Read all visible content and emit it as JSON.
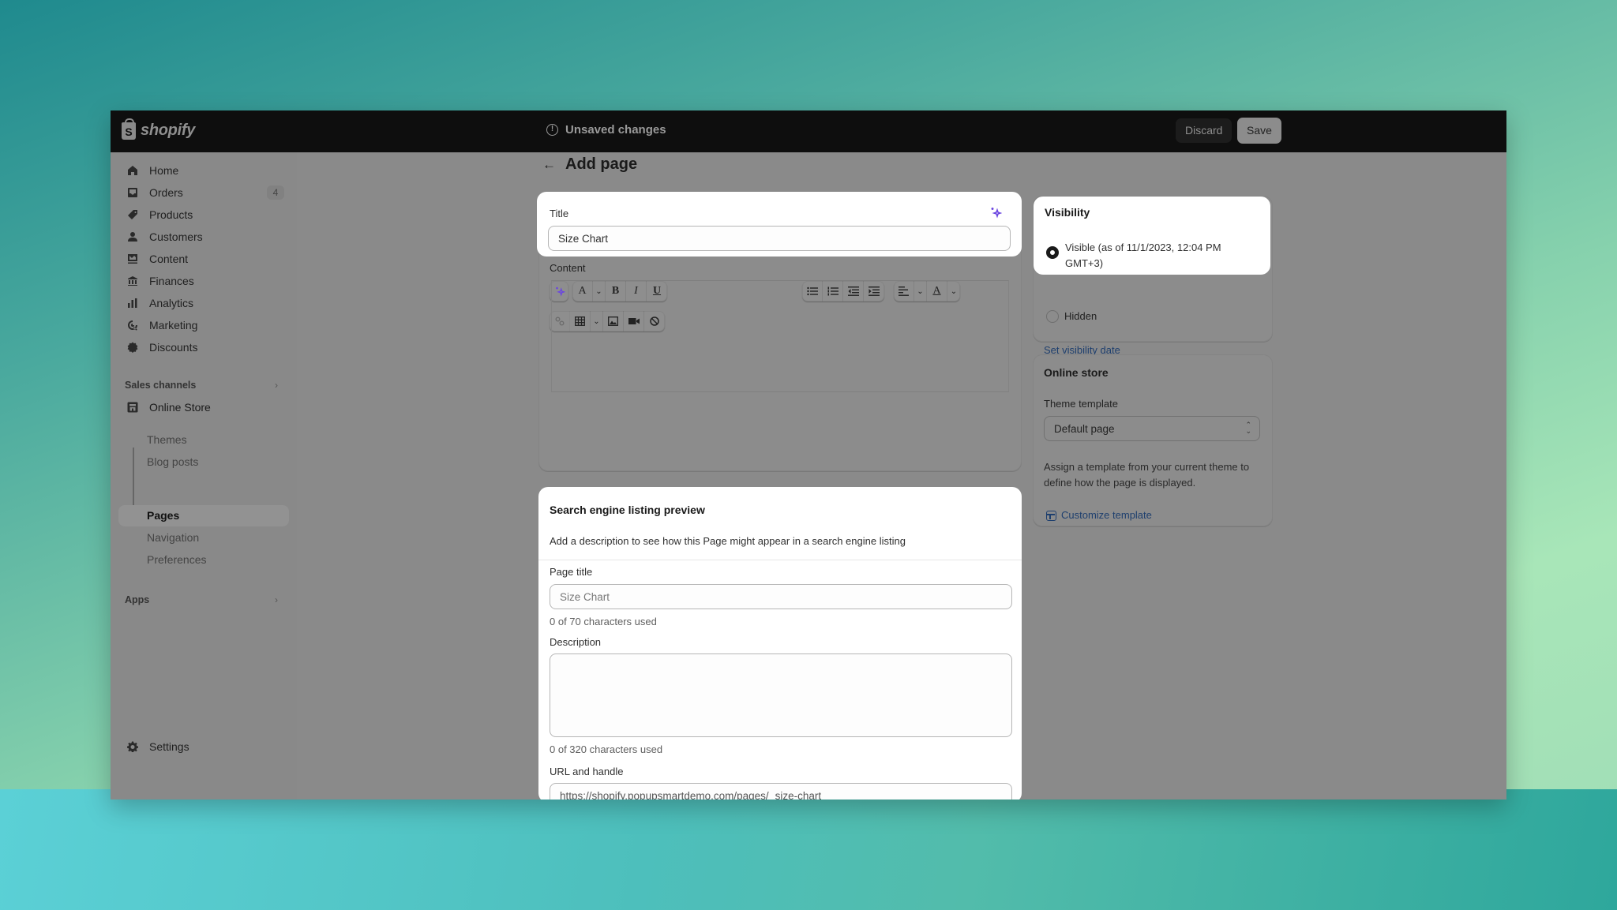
{
  "topbar": {
    "logo_text": "shopify",
    "status_text": "Unsaved changes",
    "discard_label": "Discard",
    "save_label": "Save"
  },
  "sidebar": {
    "items": [
      {
        "label": "Home",
        "icon": "home-icon"
      },
      {
        "label": "Orders",
        "icon": "inbox-icon",
        "badge": "4"
      },
      {
        "label": "Products",
        "icon": "tag-icon"
      },
      {
        "label": "Customers",
        "icon": "person-icon"
      },
      {
        "label": "Content",
        "icon": "image-icon"
      },
      {
        "label": "Finances",
        "icon": "bank-icon"
      },
      {
        "label": "Analytics",
        "icon": "bar-chart-icon"
      },
      {
        "label": "Marketing",
        "icon": "target-icon"
      },
      {
        "label": "Discounts",
        "icon": "discount-icon"
      }
    ],
    "sales_channels_label": "Sales channels",
    "online_store_label": "Online Store",
    "sub_items": [
      "Themes",
      "Blog posts",
      "Pages",
      "Navigation",
      "Preferences"
    ],
    "active_sub_item": "Pages",
    "apps_label": "Apps",
    "settings_label": "Settings"
  },
  "page": {
    "title": "Add page",
    "back_icon": "arrow-left-icon"
  },
  "title_card": {
    "title_label": "Title",
    "title_value": "Size Chart",
    "content_label": "Content"
  },
  "editor": {
    "toolbar_row1": [
      "magic",
      "font",
      "bold",
      "italic",
      "underline",
      "bullet-list",
      "numbered-list",
      "outdent",
      "indent",
      "align",
      "text-color"
    ],
    "toolbar_row2": [
      "link",
      "table",
      "image",
      "video",
      "clear-formatting"
    ],
    "html_toggle": "<>",
    "glyphs": {
      "font": "A",
      "bold": "B",
      "italic": "I",
      "underline": "U",
      "text_color": "A"
    }
  },
  "seo_card": {
    "heading": "Search engine listing preview",
    "hint": "Add a description to see how this Page might appear in a search engine listing",
    "page_title_label": "Page title",
    "page_title_placeholder": "Size Chart",
    "page_title_count": "0 of 70 characters used",
    "description_label": "Description",
    "description_value": "",
    "description_count": "0 of 320 characters used",
    "url_label": "URL and handle",
    "url_prefix": "https://shopify.popupsmartdemo.com/pages/",
    "url_handle": "size-chart"
  },
  "visibility_card": {
    "heading": "Visibility",
    "options": [
      {
        "label": "Visible (as of 11/1/2023, 12:04 PM GMT+3)",
        "selected": true
      },
      {
        "label": "Hidden",
        "selected": false
      }
    ],
    "set_date_link": "Set visibility date"
  },
  "online_store_card": {
    "heading": "Online store",
    "theme_template_label": "Theme template",
    "theme_template_value": "Default page",
    "help_text": "Assign a template from your current theme to define how the page is displayed.",
    "customize_link": "Customize template"
  },
  "colors": {
    "accent_link": "#1e3f6e",
    "magic_purple": "#6b46e0",
    "topbar": "#0e0e0e"
  }
}
